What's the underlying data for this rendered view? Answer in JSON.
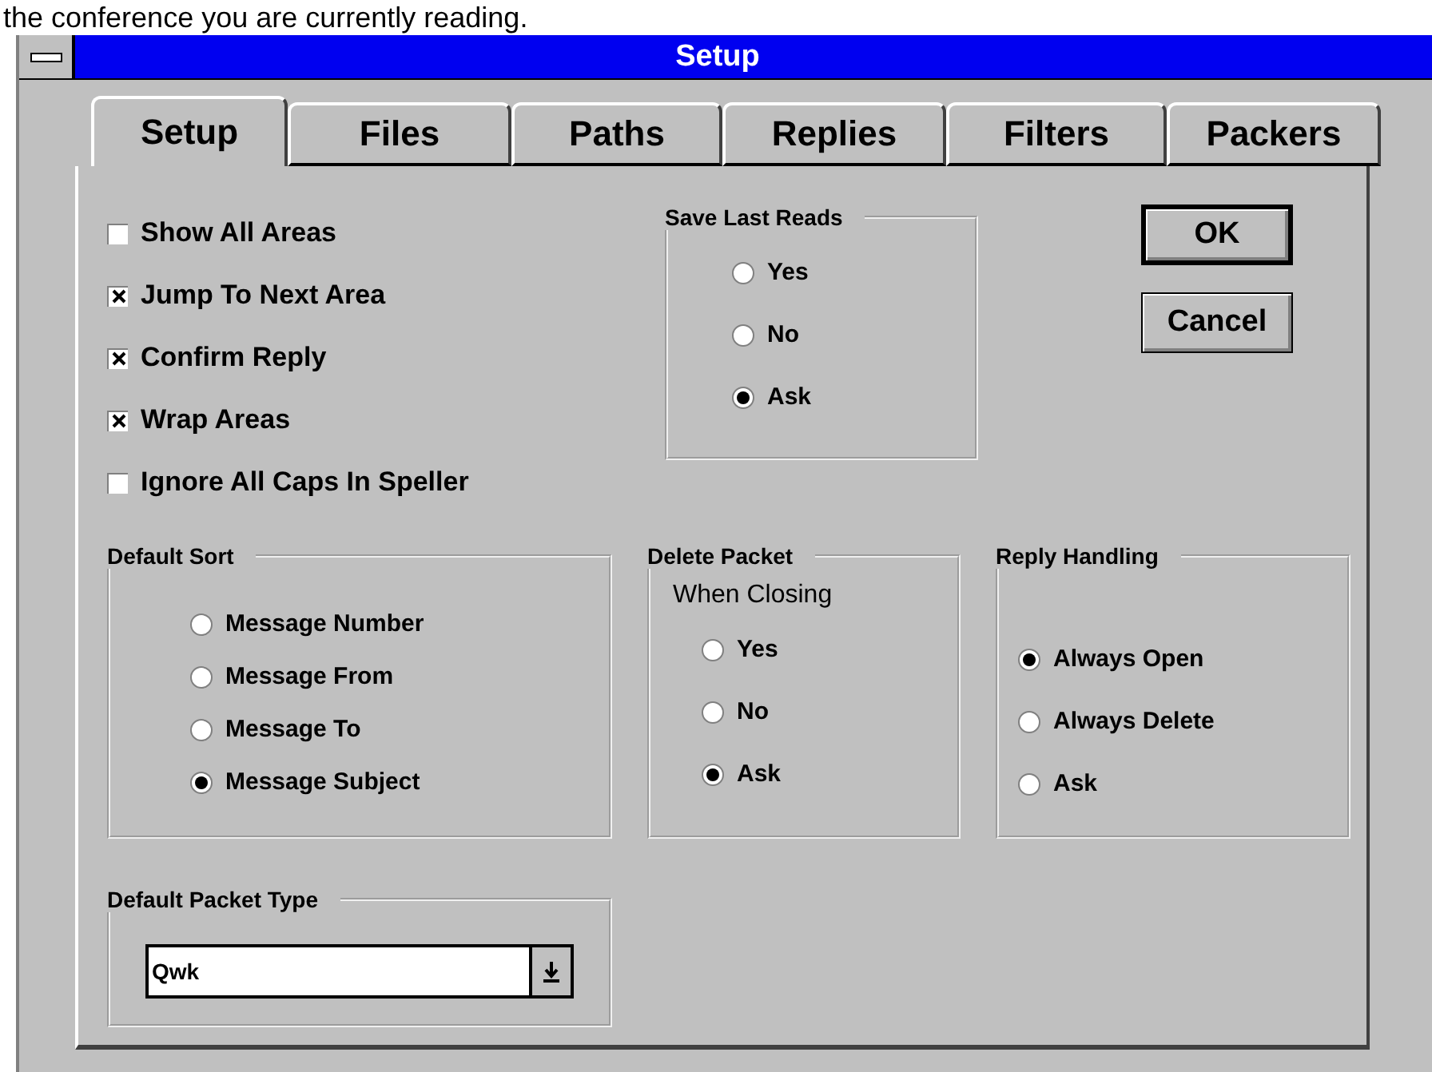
{
  "intro_text": "the conference you are currently reading.",
  "window": {
    "title": "Setup"
  },
  "tabs": [
    {
      "label": "Setup",
      "selected": true
    },
    {
      "label": "Files",
      "selected": false
    },
    {
      "label": "Paths",
      "selected": false
    },
    {
      "label": "Replies",
      "selected": false
    },
    {
      "label": "Filters",
      "selected": false
    },
    {
      "label": "Packers",
      "selected": false
    }
  ],
  "options": [
    {
      "label": "Show All Areas",
      "checked": false
    },
    {
      "label": "Jump To Next Area",
      "checked": true
    },
    {
      "label": "Confirm Reply",
      "checked": true
    },
    {
      "label": "Wrap Areas",
      "checked": true
    },
    {
      "label": "Ignore All Caps In Speller",
      "checked": false
    }
  ],
  "save_last_reads": {
    "title": "Save Last Reads",
    "options": [
      {
        "label": "Yes",
        "selected": false
      },
      {
        "label": "No",
        "selected": false
      },
      {
        "label": "Ask",
        "selected": true
      }
    ]
  },
  "buttons": [
    {
      "label": "OK",
      "default": true
    },
    {
      "label": "Cancel",
      "default": false
    }
  ],
  "default_sort": {
    "title": "Default Sort",
    "options": [
      {
        "label": "Message Number",
        "selected": false
      },
      {
        "label": "Message From",
        "selected": false
      },
      {
        "label": "Message To",
        "selected": false
      },
      {
        "label": "Message Subject",
        "selected": true
      }
    ]
  },
  "delete_packet": {
    "title": "Delete Packet",
    "subtitle": "When Closing",
    "options": [
      {
        "label": "Yes",
        "selected": false
      },
      {
        "label": "No",
        "selected": false
      },
      {
        "label": "Ask",
        "selected": true
      }
    ]
  },
  "reply_handling": {
    "title": "Reply Handling",
    "options": [
      {
        "label": "Always Open",
        "selected": true
      },
      {
        "label": "Always Delete",
        "selected": false
      },
      {
        "label": "Ask",
        "selected": false
      }
    ]
  },
  "default_packet_type": {
    "title": "Default Packet Type",
    "value": "Qwk"
  }
}
